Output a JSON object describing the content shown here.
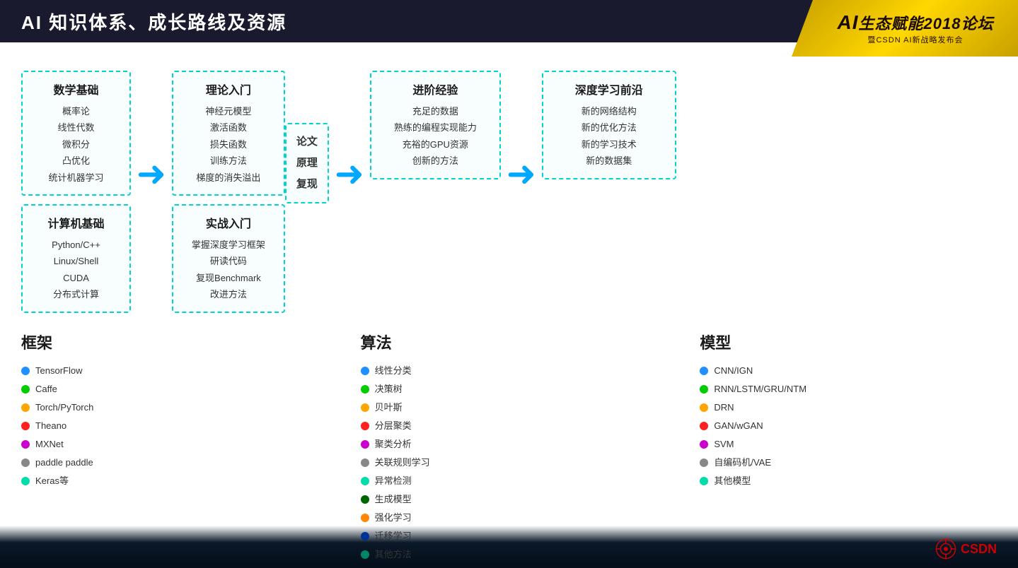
{
  "header": {
    "title": "AI 知识体系、成长路线及资源"
  },
  "top_logo": {
    "main_ai": "AI",
    "main_rest": "生态赋能2018论坛",
    "sub": "暨CSDN AI新战略发布会"
  },
  "col1": {
    "math_title": "数学基础",
    "math_items": [
      "概率论",
      "线性代数",
      "微积分",
      "凸优化",
      "统计机器学习"
    ],
    "computer_title": "计算机基础",
    "computer_items": [
      "Python/C++",
      "Linux/Shell",
      "CUDA",
      "分布式计算"
    ]
  },
  "col2": {
    "theory_title": "理论入门",
    "theory_items": [
      "神经元模型",
      "激活函数",
      "损失函数",
      "训练方法",
      "梯度的消失溢出"
    ],
    "practice_title": "实战入门",
    "practice_items": [
      "掌握深度学习框架",
      "研读代码",
      "复现Benchmark",
      "改进方法"
    ]
  },
  "paper_box": {
    "lines": [
      "论文",
      "原理",
      "复现"
    ]
  },
  "col3": {
    "title": "进阶经验",
    "items": [
      "充足的数据",
      "熟练的编程实现能力",
      "充裕的GPU资源",
      "创新的方法"
    ]
  },
  "col4": {
    "title": "深度学习前沿",
    "items": [
      "新的网络结构",
      "新的优化方法",
      "新的学习技术",
      "新的数据集"
    ]
  },
  "frameworks": {
    "title": "框架",
    "items": [
      {
        "color": "#1e90ff",
        "label": "TensorFlow"
      },
      {
        "color": "#00cc00",
        "label": "Caffe"
      },
      {
        "color": "#ffa500",
        "label": "Torch/PyTorch"
      },
      {
        "color": "#ff2020",
        "label": "Theano"
      },
      {
        "color": "#cc00cc",
        "label": "MXNet"
      },
      {
        "color": "#888888",
        "label": "paddle paddle"
      },
      {
        "color": "#00ddaa",
        "label": "Keras等"
      }
    ]
  },
  "algorithms": {
    "title": "算法",
    "items": [
      {
        "color": "#1e90ff",
        "label": "线性分类"
      },
      {
        "color": "#00cc00",
        "label": "决策树"
      },
      {
        "color": "#ffa500",
        "label": "贝叶斯"
      },
      {
        "color": "#ff2020",
        "label": "分层聚类"
      },
      {
        "color": "#cc00cc",
        "label": "聚类分析"
      },
      {
        "color": "#888888",
        "label": "关联规则学习"
      },
      {
        "color": "#00ddaa",
        "label": "异常检测"
      },
      {
        "color": "#006600",
        "label": "生成模型"
      },
      {
        "color": "#ff8800",
        "label": "强化学习"
      },
      {
        "color": "#003399",
        "label": "迁移学习"
      },
      {
        "color": "#008866",
        "label": "其他方法"
      }
    ]
  },
  "models": {
    "title": "模型",
    "items": [
      {
        "color": "#1e90ff",
        "label": "CNN/IGN"
      },
      {
        "color": "#00cc00",
        "label": "RNN/LSTM/GRU/NTM"
      },
      {
        "color": "#ffa500",
        "label": "DRN"
      },
      {
        "color": "#ff2020",
        "label": "GAN/wGAN"
      },
      {
        "color": "#cc00cc",
        "label": "SVM"
      },
      {
        "color": "#888888",
        "label": "自编码机/VAE"
      },
      {
        "color": "#00ddaa",
        "label": "其他模型"
      }
    ]
  },
  "csdn": {
    "label": "CSDN"
  }
}
